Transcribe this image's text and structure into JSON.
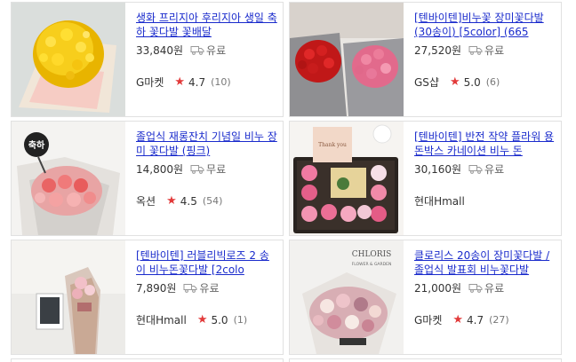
{
  "products": [
    {
      "title": "생화 프리지아 후리지아 생일 축하 꽃다발 꽃배달",
      "price": "33,840원",
      "shipping": "유료",
      "seller": "G마켓",
      "rating": "4.7",
      "reviews": "(10)"
    },
    {
      "title": "[텐바이텐]비누꽃 장미꽃다발 (30송이) [5color] (665",
      "price": "27,520원",
      "shipping": "유료",
      "seller": "GS샵",
      "rating": "5.0",
      "reviews": "(6)"
    },
    {
      "title": "졸업식 재롱잔치 기념일 비누 장미 꽃다발 (핑크)",
      "price": "14,800원",
      "shipping": "무료",
      "seller": "옥션",
      "rating": "4.5",
      "reviews": "(54)"
    },
    {
      "title": "[텐바이텐] 반전 작약 플라워 용돈박스 카네이션 비누 돈",
      "price": "30,160원",
      "shipping": "유료",
      "seller": "현대Hmall",
      "rating": "",
      "reviews": ""
    },
    {
      "title": "[텐바이텐] 러블리빅로즈 2 송이 비누돈꽃다발 [2colo",
      "price": "7,890원",
      "shipping": "유료",
      "seller": "현대Hmall",
      "rating": "5.0",
      "reviews": "(1)"
    },
    {
      "title": "클로리스 20송이 장미꽃다발 /졸업식 발표회 비누꽃다발",
      "price": "21,000원",
      "shipping": "유료",
      "seller": "G마켓",
      "rating": "4.7",
      "reviews": "(27)"
    }
  ],
  "images": {
    "p3_sign": "축하",
    "p4_card": "Thank you",
    "p6_brand": "CHLORIS",
    "p6_sub": "FLOWER & GARDEN"
  },
  "icons": {
    "shipping": "truck-icon",
    "rating": "star-icon"
  },
  "colors": {
    "link": "#1a2bcc",
    "star": "#e23a3a",
    "border": "#e1e1e1"
  }
}
